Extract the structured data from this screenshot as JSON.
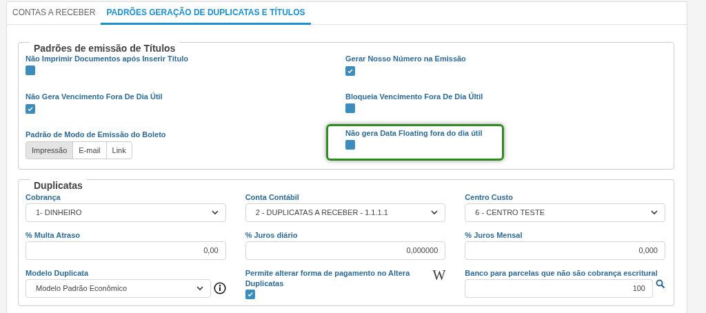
{
  "tabs": [
    {
      "label": "CONTAS A RECEBER",
      "selected": false
    },
    {
      "label": "PADRÕES GERAÇÃO DE DUPLICATAS E TÍTULOS",
      "selected": true
    }
  ],
  "titulos": {
    "legend": "Padrões de emissão de Títulos",
    "options": [
      {
        "kind": "checkbox",
        "label": "Não Imprimir Documentos após Inserir Título",
        "checked": false,
        "highlighted": false
      },
      {
        "kind": "checkbox",
        "label": "Gerar Nosso Número na Emissão",
        "checked": true,
        "highlighted": false
      },
      {
        "kind": "checkbox",
        "label": "Não Gera Vencimento Fora De Dia Útil",
        "checked": true,
        "highlighted": false
      },
      {
        "kind": "checkbox",
        "label": "Bloqueia Vencimento Fora De Dia Últil",
        "checked": false,
        "highlighted": false
      },
      {
        "kind": "segmented",
        "label": "Padrão de Modo de Emissão do Boleto",
        "buttons": [
          {
            "label": "Impressão",
            "selected": true
          },
          {
            "label": "E-mail",
            "selected": false
          },
          {
            "label": "Link",
            "selected": false
          }
        ]
      },
      {
        "kind": "checkbox",
        "label": "Não gera Data Floating fora do dia útil",
        "checked": false,
        "highlighted": true
      }
    ]
  },
  "duplicatas": {
    "legend": "Duplicatas",
    "fields": [
      {
        "kind": "select",
        "label": "Cobrança",
        "value": "1- DINHEIRO"
      },
      {
        "kind": "select",
        "label": "Conta Contábil",
        "value": "2 - DUPLICATAS A RECEBER - 1.1.1.1"
      },
      {
        "kind": "select",
        "label": "Centro Custo",
        "value": "6 - CENTRO TESTE"
      },
      {
        "kind": "number",
        "label": "% Multa Atraso",
        "value": "0,00"
      },
      {
        "kind": "number",
        "label": "% Juros diário",
        "value": "0,000000"
      },
      {
        "kind": "number",
        "label": "% Juros Mensal",
        "value": "0,000"
      },
      {
        "kind": "select-info",
        "label": "Modelo Duplicata",
        "value": "Modelo Padrão Econômico"
      },
      {
        "kind": "checkbox",
        "label": "Permite alterar forma de pagamento no Altera Duplicatas",
        "checked": true,
        "glyph": "W"
      },
      {
        "kind": "number-search",
        "label": "Banco para parcelas que não são cobrança escritural",
        "value": "100"
      }
    ]
  }
}
